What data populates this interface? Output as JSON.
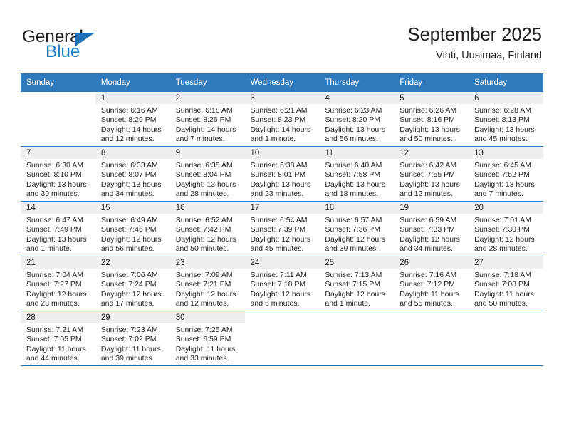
{
  "logo": {
    "word_top": "General",
    "word_bottom": "Blue",
    "triangle_color": "#1b70b8",
    "blue_color": "#1f7fc4"
  },
  "header": {
    "month_title": "September 2025",
    "location": "Vihti, Uusimaa, Finland"
  },
  "theme": {
    "header_bg": "#2f79bd",
    "daynum_bg": "#efefef",
    "text": "#231f20"
  },
  "weekday_headers": [
    "Sunday",
    "Monday",
    "Tuesday",
    "Wednesday",
    "Thursday",
    "Friday",
    "Saturday"
  ],
  "weeks": [
    [
      {
        "blank": true,
        "day": "",
        "sunrise": "",
        "sunset": "",
        "daylight1": "",
        "daylight2": ""
      },
      {
        "day": "1",
        "sunrise": "Sunrise: 6:16 AM",
        "sunset": "Sunset: 8:29 PM",
        "daylight1": "Daylight: 14 hours",
        "daylight2": "and 12 minutes."
      },
      {
        "day": "2",
        "sunrise": "Sunrise: 6:18 AM",
        "sunset": "Sunset: 8:26 PM",
        "daylight1": "Daylight: 14 hours",
        "daylight2": "and 7 minutes."
      },
      {
        "day": "3",
        "sunrise": "Sunrise: 6:21 AM",
        "sunset": "Sunset: 8:23 PM",
        "daylight1": "Daylight: 14 hours",
        "daylight2": "and 1 minute."
      },
      {
        "day": "4",
        "sunrise": "Sunrise: 6:23 AM",
        "sunset": "Sunset: 8:20 PM",
        "daylight1": "Daylight: 13 hours",
        "daylight2": "and 56 minutes."
      },
      {
        "day": "5",
        "sunrise": "Sunrise: 6:26 AM",
        "sunset": "Sunset: 8:16 PM",
        "daylight1": "Daylight: 13 hours",
        "daylight2": "and 50 minutes."
      },
      {
        "day": "6",
        "sunrise": "Sunrise: 6:28 AM",
        "sunset": "Sunset: 8:13 PM",
        "daylight1": "Daylight: 13 hours",
        "daylight2": "and 45 minutes."
      }
    ],
    [
      {
        "day": "7",
        "sunrise": "Sunrise: 6:30 AM",
        "sunset": "Sunset: 8:10 PM",
        "daylight1": "Daylight: 13 hours",
        "daylight2": "and 39 minutes."
      },
      {
        "day": "8",
        "sunrise": "Sunrise: 6:33 AM",
        "sunset": "Sunset: 8:07 PM",
        "daylight1": "Daylight: 13 hours",
        "daylight2": "and 34 minutes."
      },
      {
        "day": "9",
        "sunrise": "Sunrise: 6:35 AM",
        "sunset": "Sunset: 8:04 PM",
        "daylight1": "Daylight: 13 hours",
        "daylight2": "and 28 minutes."
      },
      {
        "day": "10",
        "sunrise": "Sunrise: 6:38 AM",
        "sunset": "Sunset: 8:01 PM",
        "daylight1": "Daylight: 13 hours",
        "daylight2": "and 23 minutes."
      },
      {
        "day": "11",
        "sunrise": "Sunrise: 6:40 AM",
        "sunset": "Sunset: 7:58 PM",
        "daylight1": "Daylight: 13 hours",
        "daylight2": "and 18 minutes."
      },
      {
        "day": "12",
        "sunrise": "Sunrise: 6:42 AM",
        "sunset": "Sunset: 7:55 PM",
        "daylight1": "Daylight: 13 hours",
        "daylight2": "and 12 minutes."
      },
      {
        "day": "13",
        "sunrise": "Sunrise: 6:45 AM",
        "sunset": "Sunset: 7:52 PM",
        "daylight1": "Daylight: 13 hours",
        "daylight2": "and 7 minutes."
      }
    ],
    [
      {
        "day": "14",
        "sunrise": "Sunrise: 6:47 AM",
        "sunset": "Sunset: 7:49 PM",
        "daylight1": "Daylight: 13 hours",
        "daylight2": "and 1 minute."
      },
      {
        "day": "15",
        "sunrise": "Sunrise: 6:49 AM",
        "sunset": "Sunset: 7:46 PM",
        "daylight1": "Daylight: 12 hours",
        "daylight2": "and 56 minutes."
      },
      {
        "day": "16",
        "sunrise": "Sunrise: 6:52 AM",
        "sunset": "Sunset: 7:42 PM",
        "daylight1": "Daylight: 12 hours",
        "daylight2": "and 50 minutes."
      },
      {
        "day": "17",
        "sunrise": "Sunrise: 6:54 AM",
        "sunset": "Sunset: 7:39 PM",
        "daylight1": "Daylight: 12 hours",
        "daylight2": "and 45 minutes."
      },
      {
        "day": "18",
        "sunrise": "Sunrise: 6:57 AM",
        "sunset": "Sunset: 7:36 PM",
        "daylight1": "Daylight: 12 hours",
        "daylight2": "and 39 minutes."
      },
      {
        "day": "19",
        "sunrise": "Sunrise: 6:59 AM",
        "sunset": "Sunset: 7:33 PM",
        "daylight1": "Daylight: 12 hours",
        "daylight2": "and 34 minutes."
      },
      {
        "day": "20",
        "sunrise": "Sunrise: 7:01 AM",
        "sunset": "Sunset: 7:30 PM",
        "daylight1": "Daylight: 12 hours",
        "daylight2": "and 28 minutes."
      }
    ],
    [
      {
        "day": "21",
        "sunrise": "Sunrise: 7:04 AM",
        "sunset": "Sunset: 7:27 PM",
        "daylight1": "Daylight: 12 hours",
        "daylight2": "and 23 minutes."
      },
      {
        "day": "22",
        "sunrise": "Sunrise: 7:06 AM",
        "sunset": "Sunset: 7:24 PM",
        "daylight1": "Daylight: 12 hours",
        "daylight2": "and 17 minutes."
      },
      {
        "day": "23",
        "sunrise": "Sunrise: 7:09 AM",
        "sunset": "Sunset: 7:21 PM",
        "daylight1": "Daylight: 12 hours",
        "daylight2": "and 12 minutes."
      },
      {
        "day": "24",
        "sunrise": "Sunrise: 7:11 AM",
        "sunset": "Sunset: 7:18 PM",
        "daylight1": "Daylight: 12 hours",
        "daylight2": "and 6 minutes."
      },
      {
        "day": "25",
        "sunrise": "Sunrise: 7:13 AM",
        "sunset": "Sunset: 7:15 PM",
        "daylight1": "Daylight: 12 hours",
        "daylight2": "and 1 minute."
      },
      {
        "day": "26",
        "sunrise": "Sunrise: 7:16 AM",
        "sunset": "Sunset: 7:12 PM",
        "daylight1": "Daylight: 11 hours",
        "daylight2": "and 55 minutes."
      },
      {
        "day": "27",
        "sunrise": "Sunrise: 7:18 AM",
        "sunset": "Sunset: 7:08 PM",
        "daylight1": "Daylight: 11 hours",
        "daylight2": "and 50 minutes."
      }
    ],
    [
      {
        "day": "28",
        "sunrise": "Sunrise: 7:21 AM",
        "sunset": "Sunset: 7:05 PM",
        "daylight1": "Daylight: 11 hours",
        "daylight2": "and 44 minutes."
      },
      {
        "day": "29",
        "sunrise": "Sunrise: 7:23 AM",
        "sunset": "Sunset: 7:02 PM",
        "daylight1": "Daylight: 11 hours",
        "daylight2": "and 39 minutes."
      },
      {
        "day": "30",
        "sunrise": "Sunrise: 7:25 AM",
        "sunset": "Sunset: 6:59 PM",
        "daylight1": "Daylight: 11 hours",
        "daylight2": "and 33 minutes."
      },
      {
        "blank": true,
        "day": "",
        "sunrise": "",
        "sunset": "",
        "daylight1": "",
        "daylight2": ""
      },
      {
        "blank": true,
        "day": "",
        "sunrise": "",
        "sunset": "",
        "daylight1": "",
        "daylight2": ""
      },
      {
        "blank": true,
        "day": "",
        "sunrise": "",
        "sunset": "",
        "daylight1": "",
        "daylight2": ""
      },
      {
        "blank": true,
        "day": "",
        "sunrise": "",
        "sunset": "",
        "daylight1": "",
        "daylight2": ""
      }
    ]
  ]
}
